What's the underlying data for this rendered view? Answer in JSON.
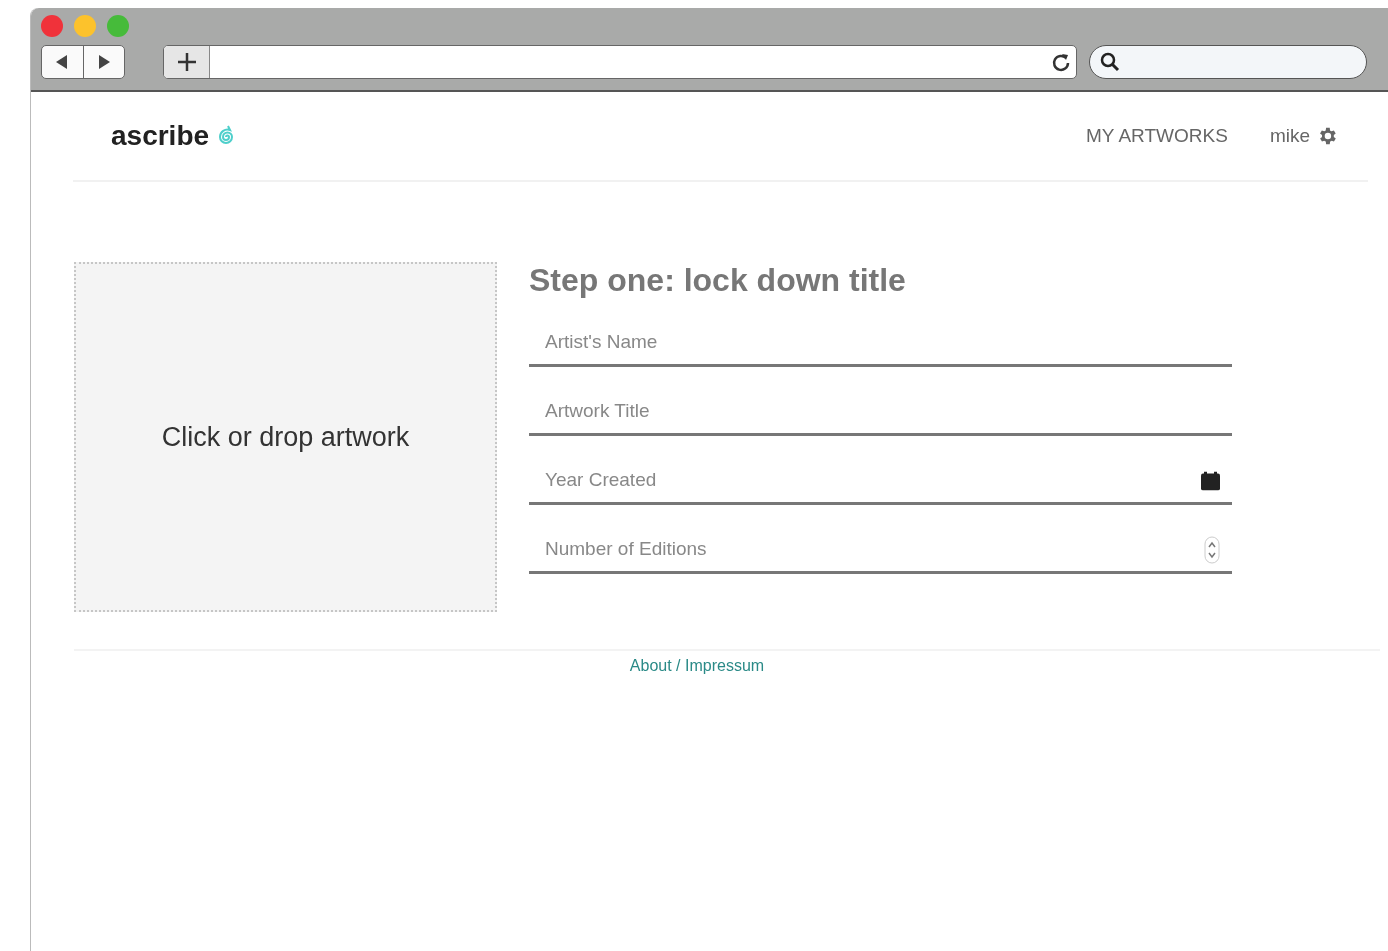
{
  "header": {
    "logo": "ascribe",
    "nav": [
      {
        "label": "MY ARTWORKS"
      },
      {
        "label": "mike"
      }
    ]
  },
  "dropzone": {
    "label": "Click or drop artwork"
  },
  "form": {
    "title": "Step one: lock down title",
    "fields": [
      {
        "kind": "text",
        "placeholder": "Artist's Name"
      },
      {
        "kind": "text",
        "placeholder": "Artwork Title"
      },
      {
        "kind": "date",
        "placeholder": "Year Created"
      },
      {
        "kind": "number",
        "placeholder": "Number of Editions"
      }
    ]
  },
  "footer": {
    "link": "About / Impressum"
  }
}
